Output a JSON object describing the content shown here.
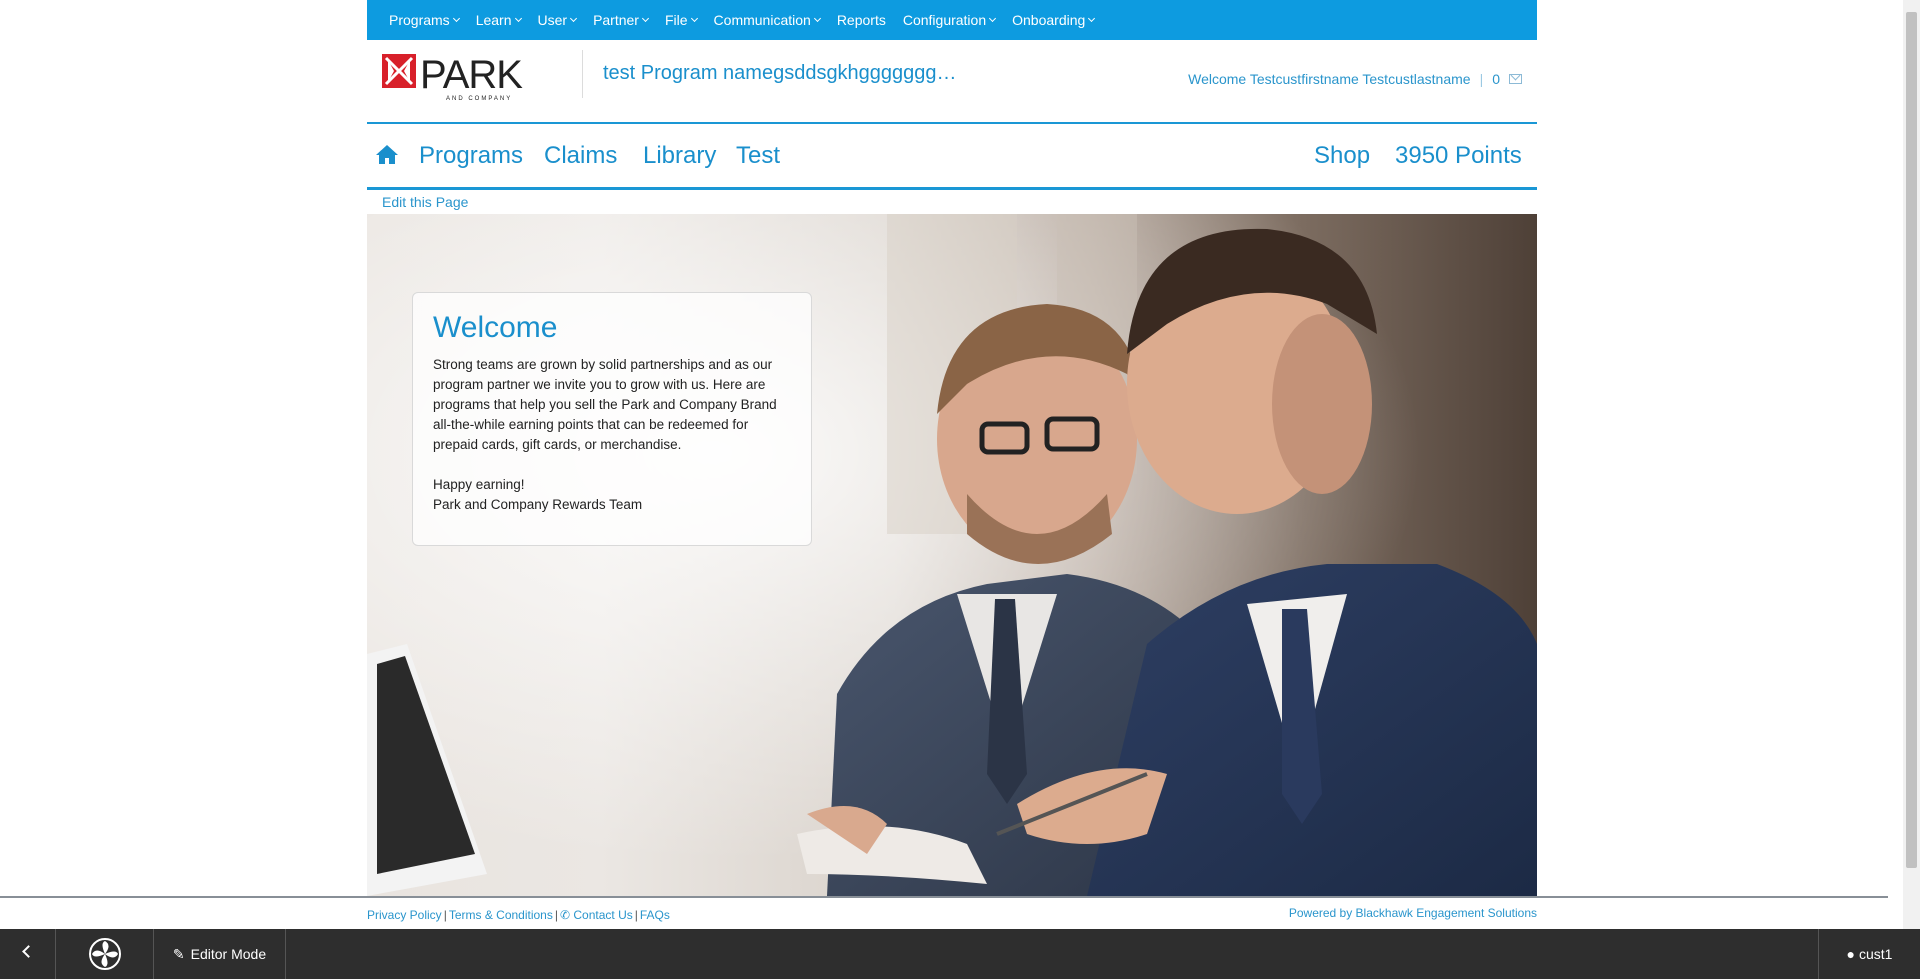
{
  "admin_menu": [
    {
      "label": "Programs",
      "dropdown": true
    },
    {
      "label": "Learn",
      "dropdown": true
    },
    {
      "label": "User",
      "dropdown": true
    },
    {
      "label": "Partner",
      "dropdown": true
    },
    {
      "label": "File",
      "dropdown": true
    },
    {
      "label": "Communication",
      "dropdown": true
    },
    {
      "label": "Reports",
      "dropdown": false
    },
    {
      "label": "Configuration",
      "dropdown": true
    },
    {
      "label": "Onboarding",
      "dropdown": true
    }
  ],
  "header": {
    "logo_text": "PARK",
    "logo_subtext": "AND COMPANY",
    "program_name": "test Program namegsddsgkhggggggg…",
    "welcome_text": "Welcome Testcustfirstname Testcustlastname",
    "separator": "|",
    "message_count": "0"
  },
  "main_nav": {
    "programs": "Programs",
    "claims": "Claims",
    "library": "Library",
    "test": "Test",
    "shop": "Shop",
    "points": "3950 Points"
  },
  "edit_link": "Edit this Page",
  "welcome_card": {
    "title": "Welcome",
    "body": "Strong teams are grown by solid partnerships and as our program partner we invite you to grow with us. Here are programs that help you sell the Park and Company Brand all-the-while earning points that can be redeemed for prepaid cards, gift cards, or merchandise.\n\nHappy earning!\nPark and Company Rewards Team"
  },
  "footer": {
    "privacy": "Privacy Policy",
    "terms": "Terms & Conditions",
    "contact": "Contact Us",
    "faqs": "FAQs",
    "powered": "Powered by Blackhawk Engagement Solutions"
  },
  "editor_bar": {
    "editor_mode": "Editor Mode",
    "user": "cust1"
  },
  "colors": {
    "brand_blue": "#0d9be0",
    "link_blue": "#1a8fcc",
    "editor_bar": "#2e2e2e"
  }
}
